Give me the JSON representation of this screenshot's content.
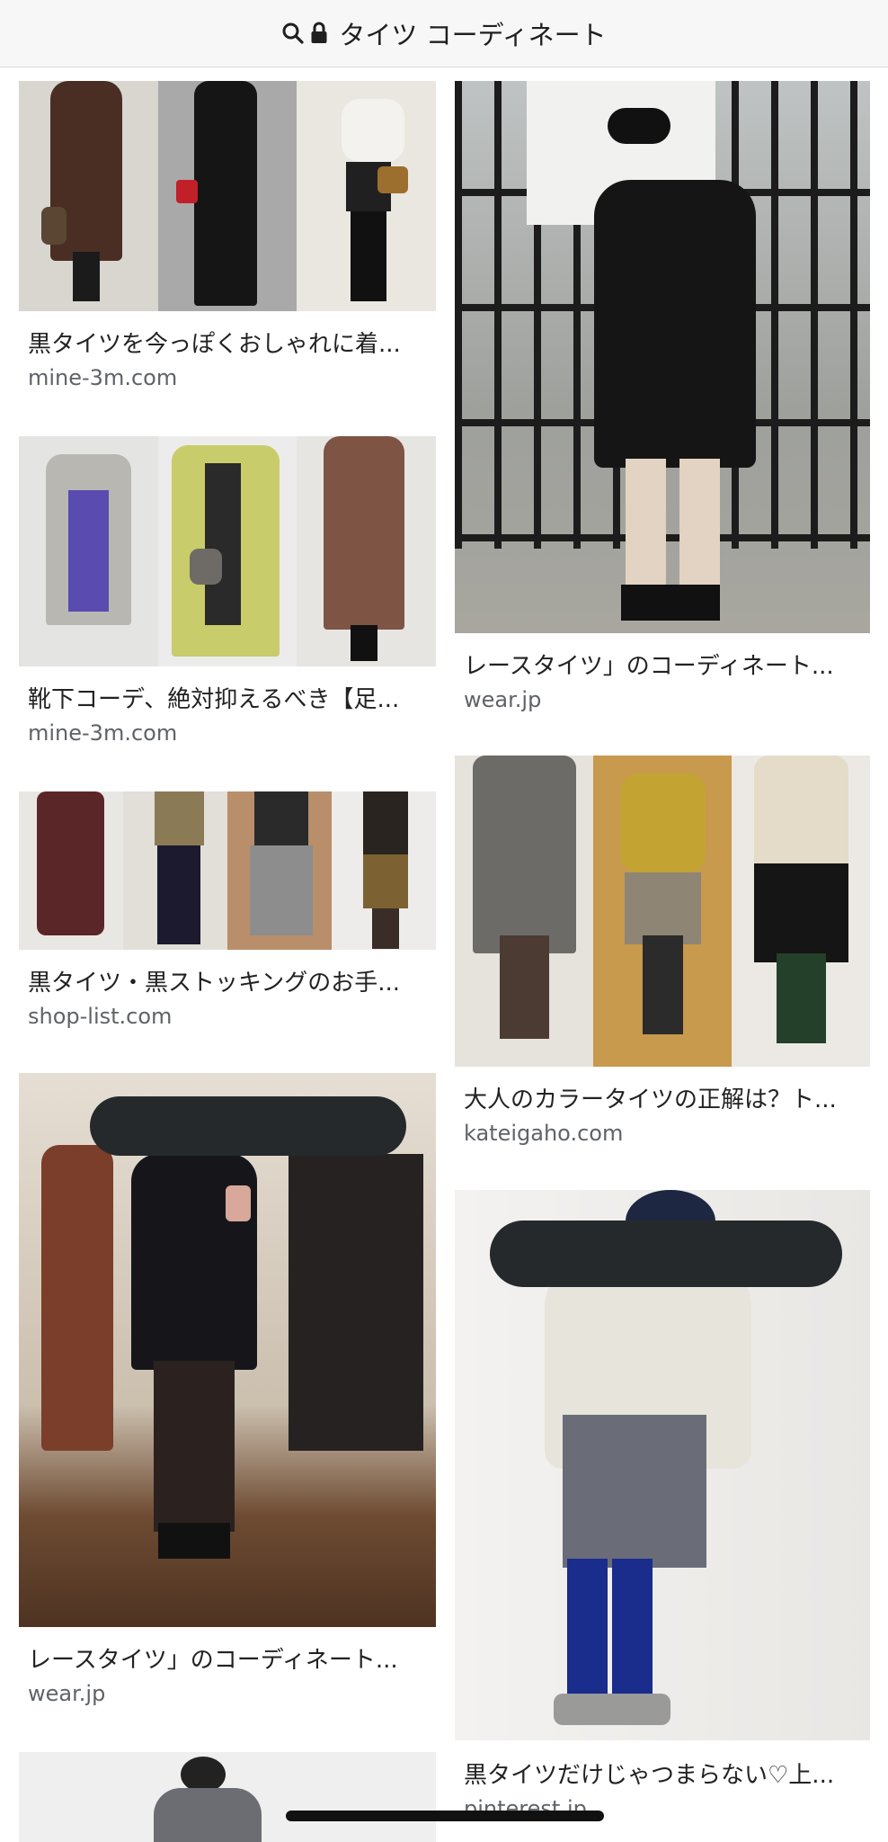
{
  "header": {
    "query": "タイツ コーディネート",
    "search_icon": "search-icon",
    "lock_icon": "lock-icon"
  },
  "results": [
    {
      "title": "黒タイツを今っぽくおしゃれに着...",
      "source": "mine-3m.com"
    },
    {
      "title": "靴下コーデ、絶対抑えるべき【足...",
      "source": "mine-3m.com"
    },
    {
      "title": "黒タイツ・黒ストッキングのお手...",
      "source": "shop-list.com"
    },
    {
      "title": "レースタイツ」のコーディネート...",
      "source": "wear.jp"
    },
    {
      "title": "レースタイツ」のコーディネート...",
      "source": "wear.jp"
    },
    {
      "title": "大人のカラータイツの正解は？ト...",
      "source": "kateigaho.com"
    },
    {
      "title": "黒タイツだけじゃつまらない♡上...",
      "source": "pinterest.jp"
    }
  ],
  "colors": {
    "header_bg": "#f7f7f7",
    "redaction": "#26292c",
    "source_text": "#5f6368"
  }
}
